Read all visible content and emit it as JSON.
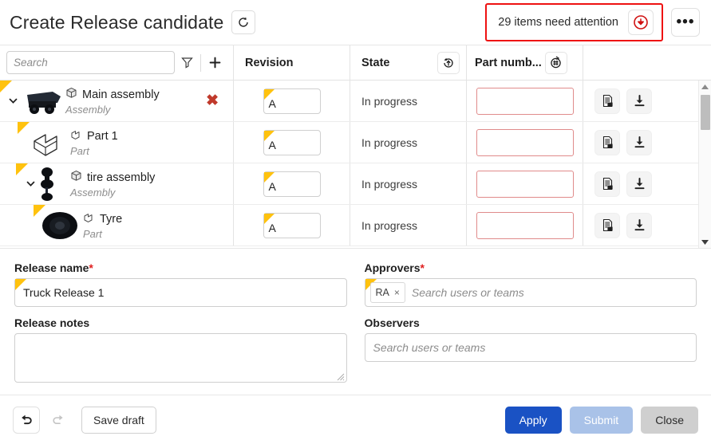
{
  "header": {
    "title": "Create Release candidate",
    "refresh_icon": "rotate-icon",
    "attention_text": "29 items need attention",
    "attention_icon": "red-down-arrow-icon",
    "more_icon": "kebab-menu-icon"
  },
  "toolbar": {
    "search_placeholder": "Search",
    "search_value": "",
    "filter_icon": "funnel-icon",
    "add_icon": "plus-icon"
  },
  "table": {
    "columns": {
      "revision": "Revision",
      "state": "State",
      "state_icon": "circular-arrow-up-icon",
      "part_number": "Part numb...",
      "part_number_icon": "hash-circular-arrow-icon"
    },
    "rows": [
      {
        "name": "Main assembly",
        "type": "Assembly",
        "type_icon": "cube-icon",
        "thumbnail": "truck-thumbnail",
        "indent": 0,
        "expanded": true,
        "has_chevron": true,
        "has_delete": true,
        "revision": "A",
        "state": "In progress",
        "part_number": "",
        "part_number_placeholder": ""
      },
      {
        "name": "Part 1",
        "type": "Part",
        "type_icon": "part-icon",
        "thumbnail": "lbracket-part-thumbnail",
        "indent": 1,
        "expanded": false,
        "has_chevron": false,
        "has_delete": false,
        "revision": "A",
        "state": "In progress",
        "part_number": "",
        "part_number_placeholder": ""
      },
      {
        "name": "tire assembly",
        "type": "Assembly",
        "type_icon": "cube-icon",
        "thumbnail": "axle-thumbnail",
        "indent": 1,
        "expanded": true,
        "has_chevron": true,
        "has_delete": false,
        "revision": "A",
        "state": "In progress",
        "part_number": "",
        "part_number_placeholder": ""
      },
      {
        "name": "Tyre",
        "type": "Part",
        "type_icon": "part-icon",
        "thumbnail": "tyre-thumbnail",
        "indent": 2,
        "expanded": false,
        "has_chevron": false,
        "has_delete": false,
        "revision": "A",
        "state": "In progress",
        "part_number": "",
        "part_number_placeholder": ""
      }
    ],
    "row_actions": {
      "bom_icon": "document-bom-icon",
      "download_icon": "download-icon"
    },
    "scrollbar": {
      "up_icon": "scroll-up-arrow-icon",
      "down_icon": "scroll-down-arrow-icon"
    }
  },
  "form": {
    "release_name_label": "Release name",
    "release_name_required": "*",
    "release_name_value": "Truck Release 1",
    "release_notes_label": "Release notes",
    "release_notes_value": "",
    "approvers_label": "Approvers",
    "approvers_required": "*",
    "approvers_chip": "RA",
    "approvers_chip_remove": "×",
    "approvers_placeholder": "Search users or teams",
    "observers_label": "Observers",
    "observers_placeholder": "Search users or teams"
  },
  "footer": {
    "undo_icon": "undo-arrow-icon",
    "redo_icon": "redo-arrow-icon",
    "save_draft_label": "Save draft",
    "apply_label": "Apply",
    "submit_label": "Submit",
    "close_label": "Close"
  },
  "colors": {
    "accent_yellow": "#ffc20e",
    "attention_red": "#ee1111",
    "delete_red": "#c0392b",
    "apply_blue": "#1a52c4",
    "submit_blue": "#a9c2e8",
    "close_grey": "#cfcfcf"
  }
}
